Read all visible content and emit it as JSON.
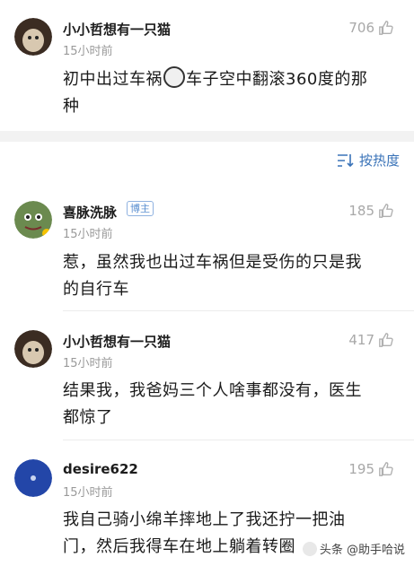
{
  "comments": [
    {
      "name": "小小哲想有一只猫",
      "time": "15小时前",
      "likes": "706",
      "text_lines": [
        "初中出过车祸",
        "车子空中翻滚360度的那",
        "种"
      ],
      "emoji": "hurt-face"
    },
    {
      "name": "喜脉洗脉",
      "badge": "博主",
      "time": "15小时前",
      "likes": "185",
      "text_lines": [
        "惹，虽然我也出过车祸但是受伤的只是我",
        "的自行车"
      ]
    },
    {
      "name": "小小哲想有一只猫",
      "time": "15小时前",
      "likes": "417",
      "text_lines": [
        "结果我，我爸妈三个人啥事都没有，医生",
        "都惊了"
      ]
    },
    {
      "name": "desire622",
      "time": "15小时前",
      "likes": "195",
      "text_lines": [
        "我自己骑小绵羊摔地上了我还拧一把油",
        "门，然后我得车在地上躺着转圈"
      ]
    }
  ],
  "sort": {
    "label": "按热度",
    "icon": "sort-icon"
  },
  "watermark": {
    "text": "头条 @助手哈说"
  },
  "colors": {
    "accent": "#3a73b8",
    "muted": "#9a9a9a",
    "divider": "#ececec"
  }
}
